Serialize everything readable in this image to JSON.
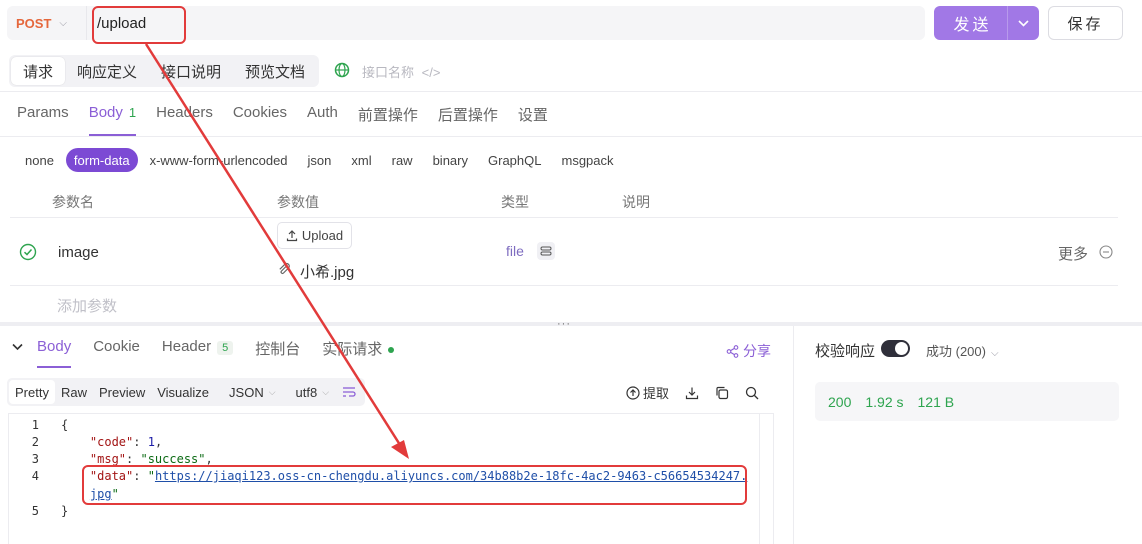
{
  "request": {
    "method": "POST",
    "url": "/upload",
    "send_label": "发送",
    "save_label": "保存"
  },
  "mode_tabs": [
    "请求",
    "响应定义",
    "接口说明",
    "预览文档"
  ],
  "interface_name_placeholder": "接口名称",
  "param_tabs": [
    {
      "label": "Params"
    },
    {
      "label": "Body",
      "count": "1"
    },
    {
      "label": "Headers"
    },
    {
      "label": "Cookies"
    },
    {
      "label": "Auth"
    },
    {
      "label": "前置操作"
    },
    {
      "label": "后置操作"
    },
    {
      "label": "设置"
    }
  ],
  "body_types": [
    "none",
    "form-data",
    "x-www-form-urlencoded",
    "json",
    "xml",
    "raw",
    "binary",
    "GraphQL",
    "msgpack"
  ],
  "table": {
    "headers": [
      "参数名",
      "参数值",
      "类型",
      "说明"
    ],
    "row": {
      "name": "image",
      "upload_label": "Upload",
      "file_name": "小希.jpg",
      "type": "file",
      "more": "更多"
    },
    "add_param": "添加参数"
  },
  "response": {
    "tabs": [
      {
        "label": "Body"
      },
      {
        "label": "Cookie"
      },
      {
        "label": "Header",
        "count": "5"
      },
      {
        "label": "控制台"
      },
      {
        "label": "实际请求"
      }
    ],
    "share": "分享",
    "view_modes": [
      "Pretty",
      "Raw",
      "Preview",
      "Visualize"
    ],
    "format": "JSON",
    "encoding": "utf8",
    "extract": "提取",
    "code_lines": [
      {
        "n": "1",
        "text": "{"
      },
      {
        "n": "2",
        "key": "\"code\"",
        "num": "1"
      },
      {
        "n": "3",
        "key": "\"msg\"",
        "str": "\"success\""
      },
      {
        "n": "4",
        "key": "\"data\"",
        "url_a": "https://jiaqi123.oss-cn-chengdu.aliyuncs.com/34b88b2e-18fc-4ac2-9463-c56654534247.",
        "url_b": "jpg"
      },
      {
        "n": "5",
        "text": "}"
      }
    ]
  },
  "validation": {
    "label": "校验响应",
    "status_option": "成功 (200)",
    "status_code": "200",
    "time": "1.92 s",
    "size": "121 B"
  },
  "colors": {
    "accent": "#8b5fd6",
    "send_button": "#a178e6",
    "method": "#e5673c",
    "success": "#2ea44f",
    "annotation": "#e23b3b"
  }
}
